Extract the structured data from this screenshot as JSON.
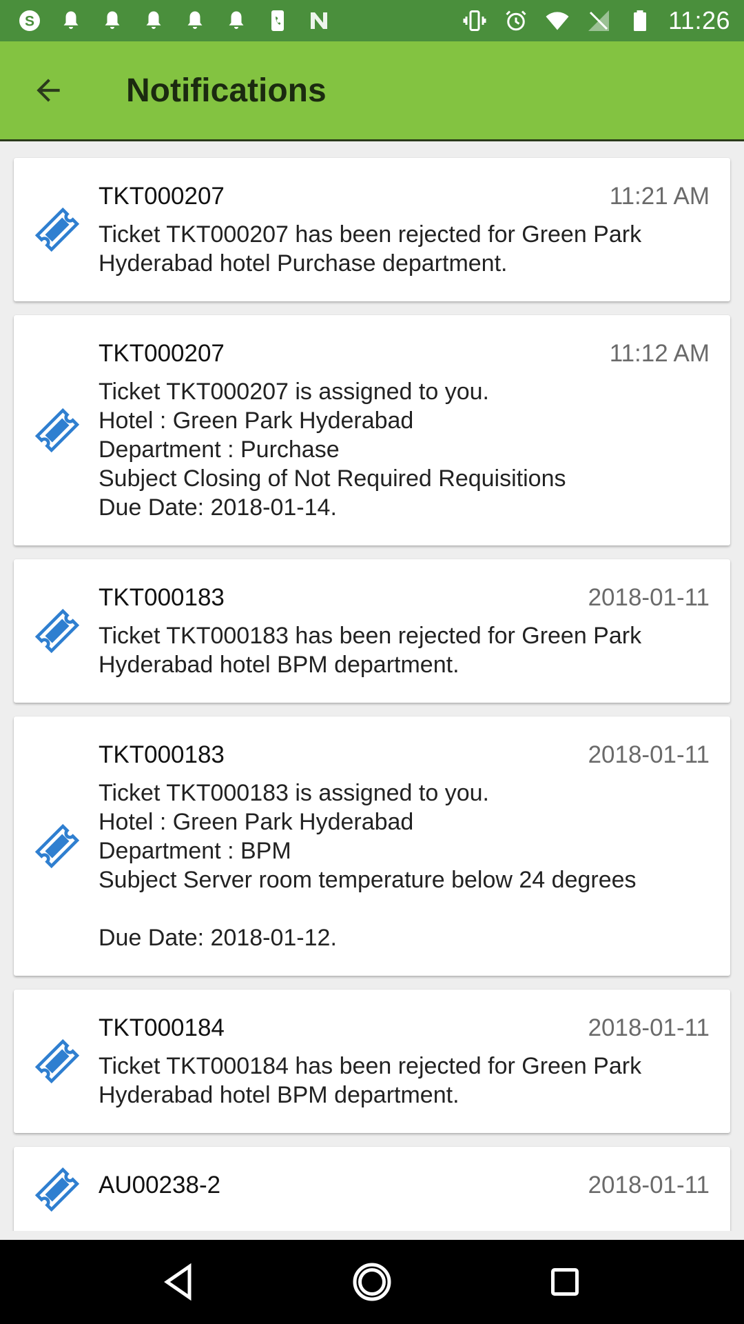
{
  "status_bar": {
    "time": "11:26",
    "left_icons": [
      "skype-icon",
      "bell-icon",
      "bell-icon",
      "bell-icon",
      "bell-icon",
      "bell-icon",
      "phone-icon",
      "n-app-icon"
    ],
    "right_icons": [
      "vibrate-icon",
      "alarm-icon",
      "wifi-icon",
      "no-signal-icon",
      "battery-icon"
    ]
  },
  "app_bar": {
    "title": "Notifications",
    "back_icon": "arrow-left-icon"
  },
  "colors": {
    "status_bar": "#4a8f3c",
    "app_bar": "#83c341",
    "icon_accent": "#2f7fd0"
  },
  "notifications": [
    {
      "title": "TKT000207",
      "time": "11:21 AM",
      "message": "Ticket TKT000207  has been rejected for Green Park Hyderabad hotel Purchase  department."
    },
    {
      "title": "TKT000207",
      "time": "11:12 AM",
      "message": "Ticket TKT000207 is assigned to you.\nHotel : Green Park Hyderabad\nDepartment : Purchase\nSubject Closing of Not Required Requisitions\nDue Date: 2018-01-14."
    },
    {
      "title": "TKT000183",
      "time": "2018-01-11",
      "message": "Ticket TKT000183  has been rejected for Green Park Hyderabad hotel BPM department."
    },
    {
      "title": "TKT000183",
      "time": "2018-01-11",
      "message": "Ticket TKT000183 is assigned to you.\nHotel : Green Park Hyderabad\nDepartment : BPM\nSubject Server room temperature below 24 degrees\n\nDue Date: 2018-01-12."
    },
    {
      "title": "TKT000184",
      "time": "2018-01-11",
      "message": "Ticket TKT000184  has been rejected for Green Park Hyderabad hotel BPM department."
    },
    {
      "title": "AU00238-2",
      "time": "2018-01-11",
      "message": ""
    }
  ],
  "nav_bar": {
    "buttons": [
      "back-triangle-icon",
      "home-circle-icon",
      "recents-square-icon"
    ]
  }
}
